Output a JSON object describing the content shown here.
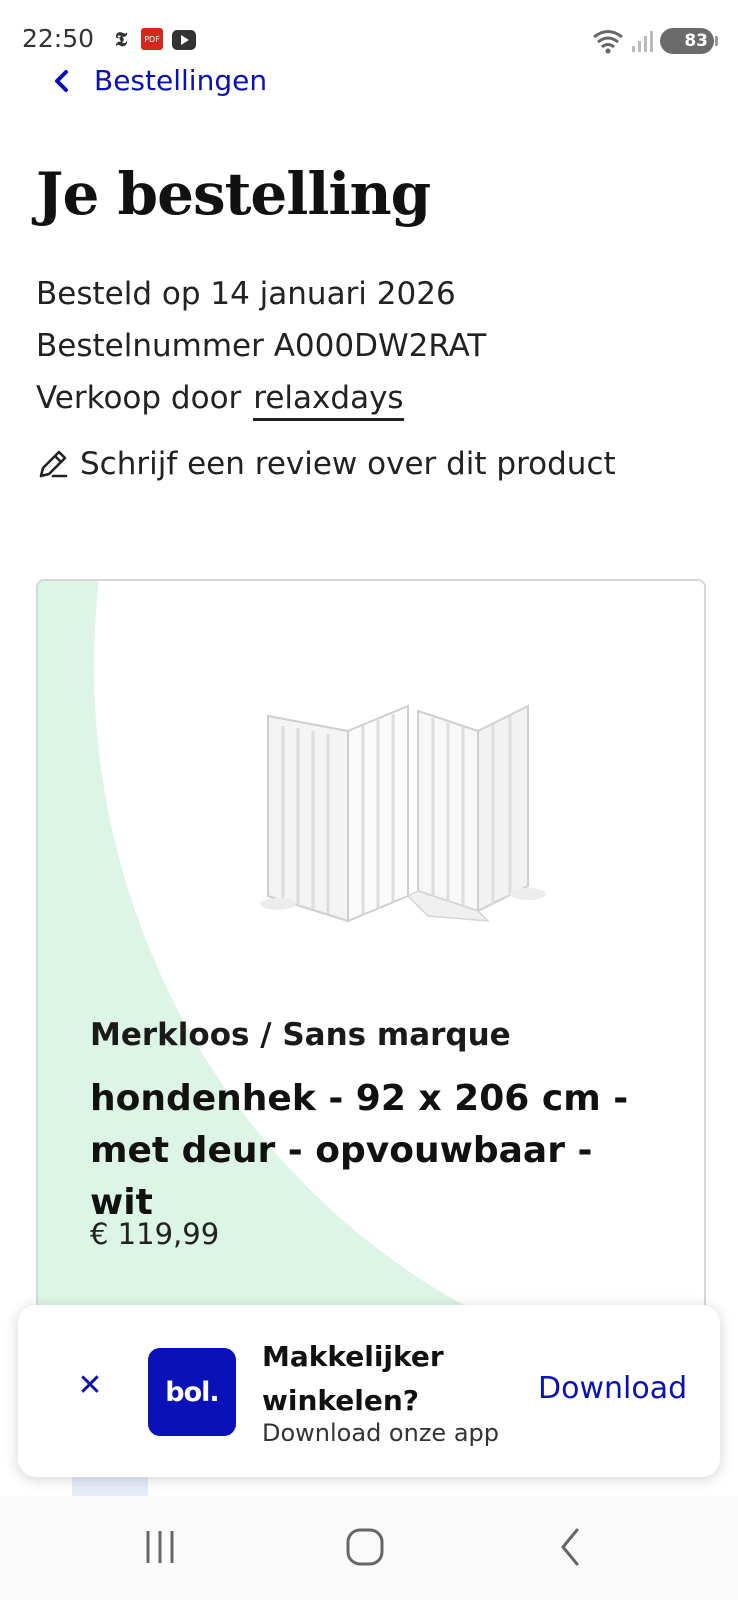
{
  "status_bar": {
    "time": "22:50",
    "battery": "83",
    "wifi_badge": "6",
    "notification_icons": [
      "telegraaf-icon",
      "pdf-icon",
      "youtube-icon"
    ]
  },
  "nav": {
    "back_label": "Bestellingen"
  },
  "page": {
    "title": "Je bestelling",
    "ordered_on": "Besteld op 14 januari 2026",
    "order_number": "Bestelnummer A000DW2RAT",
    "sold_by_label": "Verkoop door",
    "seller": "relaxdays",
    "review_link": "Schrijf een review over dit product"
  },
  "product": {
    "brand": "Merkloos / Sans marque",
    "name": "hondenhek - 92 x 206 cm - met deur - opvouwbaar - wit",
    "price": "€ 119,99"
  },
  "app_banner": {
    "logo_text": "bol.",
    "title": "Makkelijker winkelen?",
    "subtitle": "Download onze app",
    "download_label": "Download"
  },
  "colors": {
    "brand_blue": "#0b11b9",
    "card_green": "#dcf5e7"
  }
}
